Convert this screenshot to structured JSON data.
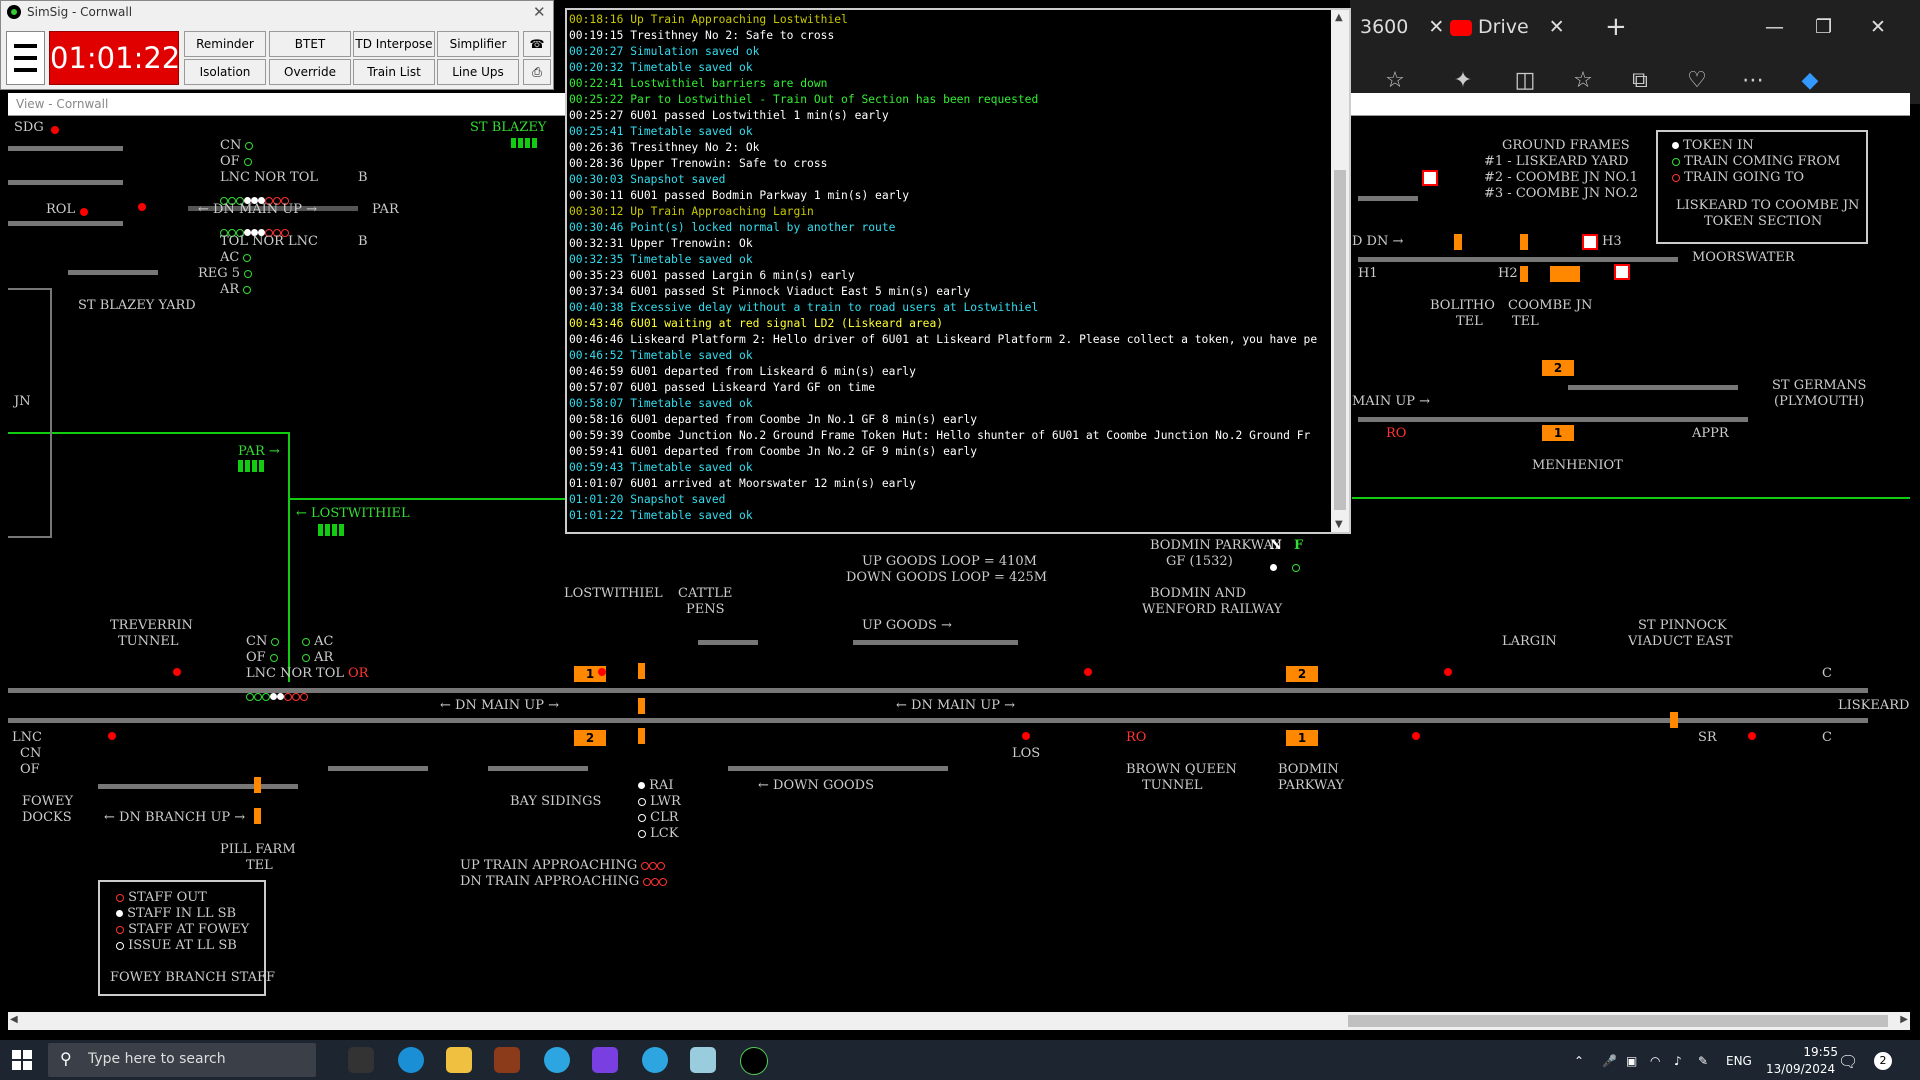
{
  "edge": {
    "tab1_text": "3600",
    "tab2_text": "Drive",
    "close_glyph": "✕",
    "plus_glyph": "+",
    "window_min": "—",
    "window_restore": "❐",
    "window_close": "✕"
  },
  "simsig": {
    "title": "SimSig - Cornwall",
    "clock": "01:01:22",
    "buttons": [
      "Reminder",
      "BTET",
      "TD Interpose",
      "Simplifier",
      "Isolation",
      "Override",
      "Train List",
      "Line Ups"
    ]
  },
  "view": {
    "title": "View - Cornwall"
  },
  "log": [
    {
      "t": "00:18:16 Up Train Approaching Lostwithiel",
      "c": "#c8c800"
    },
    {
      "t": "00:19:15 Tresithney No 2: Safe to cross",
      "c": "#ffffff"
    },
    {
      "t": "00:20:27 Simulation saved ok",
      "c": "#33ddee"
    },
    {
      "t": "00:20:32 Timetable saved ok",
      "c": "#33ddee"
    },
    {
      "t": "00:22:41 Lostwithiel barriers are down",
      "c": "#33ee33"
    },
    {
      "t": "00:25:22 Par to Lostwithiel - Train Out of Section has been requested",
      "c": "#33ee33"
    },
    {
      "t": "00:25:27 6U01 passed Lostwithiel 1 min(s) early",
      "c": "#ffffff"
    },
    {
      "t": "00:25:41 Timetable saved ok",
      "c": "#33ddee"
    },
    {
      "t": "00:26:36 Tresithney No 2: Ok",
      "c": "#ffffff"
    },
    {
      "t": "00:28:36 Upper Trenowin: Safe to cross",
      "c": "#ffffff"
    },
    {
      "t": "00:30:03 Snapshot saved",
      "c": "#33ddee"
    },
    {
      "t": "00:30:11 6U01 passed Bodmin Parkway 1 min(s) early",
      "c": "#ffffff"
    },
    {
      "t": "00:30:12 Up Train Approaching Largin",
      "c": "#c8c800"
    },
    {
      "t": "00:30:46 Point(s) locked normal by another route",
      "c": "#33ddee"
    },
    {
      "t": "00:32:31 Upper Trenowin: Ok",
      "c": "#ffffff"
    },
    {
      "t": "00:32:35 Timetable saved ok",
      "c": "#33ddee"
    },
    {
      "t": "00:35:23 6U01 passed Largin 6 min(s) early",
      "c": "#ffffff"
    },
    {
      "t": "00:37:34 6U01 passed St Pinnock Viaduct East 5 min(s) early",
      "c": "#ffffff"
    },
    {
      "t": "00:40:38 Excessive delay without a train to road users at Lostwithiel",
      "c": "#33ddee"
    },
    {
      "t": "00:43:46 6U01 waiting at red signal LD2 (Liskeard area)",
      "c": "#ffff33"
    },
    {
      "t": "00:46:46 Liskeard Platform 2: Hello driver of 6U01 at Liskeard Platform 2. Please collect a token, you have pe",
      "c": "#ffffff"
    },
    {
      "t": "00:46:52 Timetable saved ok",
      "c": "#33ddee"
    },
    {
      "t": "00:46:59 6U01 departed from Liskeard 6 min(s) early",
      "c": "#ffffff"
    },
    {
      "t": "00:57:07 6U01 passed Liskeard Yard GF on time",
      "c": "#ffffff"
    },
    {
      "t": "00:58:07 Timetable saved ok",
      "c": "#33ddee"
    },
    {
      "t": "00:58:16 6U01 departed from Coombe Jn No.1 GF 8 min(s) early",
      "c": "#ffffff"
    },
    {
      "t": "00:59:39 Coombe Junction No.2 Ground Frame Token Hut: Hello shunter of 6U01 at Coombe Junction No.2 Ground Fr",
      "c": "#ffffff"
    },
    {
      "t": "00:59:41 6U01 departed from Coombe Jn No.2 GF 9 min(s) early",
      "c": "#ffffff"
    },
    {
      "t": "00:59:43 Timetable saved ok",
      "c": "#33ddee"
    },
    {
      "t": "01:01:07 6U01 arrived at Moorswater 12 min(s) early",
      "c": "#ffffff"
    },
    {
      "t": "01:01:20 Snapshot saved",
      "c": "#33ddee"
    },
    {
      "t": "01:01:22 Timetable saved ok",
      "c": "#33ddee"
    }
  ],
  "diagram": {
    "sdg": "SDG",
    "st_blazey": "ST BLAZEY",
    "rol": "ROL",
    "st_blazey_yard": "ST BLAZEY YARD",
    "par_left": "PAR",
    "cn1": "CN",
    "of1": "OF",
    "lnc_nor_tol": "LNC NOR TOL",
    "b1": "B",
    "dn_main_up1": "← DN MAIN UP →",
    "tol_nor_lnc": "TOL NOR LNC",
    "b2": "B",
    "ac1": "AC",
    "reg5": "REG 5",
    "ar1": "AR",
    "jn_left": "JN",
    "par_green": "PAR →",
    "lostwithiel_green": "← LOSTWITHIEL",
    "ground_frames": "GROUND FRAMES",
    "gf1": "#1 - LISKEARD YARD",
    "gf2": "#2 - COOMBE JN NO.1",
    "gf3": "#3 - COOMBE JN NO.2",
    "token_in": "TOKEN IN",
    "train_coming_from": "TRAIN COMING FROM",
    "train_going_to": "TRAIN GOING TO",
    "token_section": "LISKEARD TO COOMBE JN",
    "token_section2": "TOKEN SECTION",
    "dn_right": "D DN →",
    "h1": "H1",
    "h2": "H2",
    "h3": "H3",
    "moorswater": "MOORSWATER",
    "bolitho": "BOLITHO",
    "bolitho_tel": "TEL",
    "coombe_jn": "COOMBE JN",
    "coombe_tel": "TEL",
    "box2_top": "2",
    "box1_top": "1",
    "st_germans": "ST GERMANS",
    "plymouth": "(PLYMOUTH)",
    "main_up_right": "MAIN UP →",
    "ro_right": "RO",
    "appr": "APPR",
    "menheniot": "MENHENIOT",
    "bodmin_pw_gf": "BODMIN PARKWAY",
    "bodmin_gf_num": "GF (1532)",
    "n_lbl": "N",
    "f_lbl": "F",
    "up_goods_loop": "UP GOODS LOOP = 410M",
    "down_goods_loop": "DOWN GOODS LOOP = 425M",
    "lostwithiel": "LOSTWITHIEL",
    "cattle": "CATTLE",
    "pens": "PENS",
    "bodmin_wenford1": "BODMIN AND",
    "bodmin_wenford2": "WENFORD RAILWAY",
    "treverrin1": "TREVERRIN",
    "treverrin2": "TUNNEL",
    "cn2": "CN",
    "of2": "OF",
    "ac2": "AC",
    "ar2": "AR",
    "lnc_nor_tol2": "LNC NOR TOL",
    "or_lbl": "OR",
    "up_goods": "UP GOODS →",
    "largin": "LARGIN",
    "st_pinnock1": "ST PINNOCK",
    "st_pinnock2": "VIADUCT EAST",
    "c_top": "C",
    "liskeard": "LISKEARD",
    "c_bot": "C",
    "dn_main_up2": "← DN MAIN UP →",
    "dn_main_up3": "← DN MAIN UP →",
    "box1_mid": "1",
    "box2_mid": "2",
    "box2_right": "2",
    "box1_right": "1",
    "lnc3": "LNC",
    "cn3": "CN",
    "of3": "OF",
    "los": "LOS",
    "sr": "SR",
    "ro_mid": "RO",
    "fowey1": "FOWEY",
    "fowey2": "DOCKS",
    "dn_branch_up": "← DN BRANCH UP →",
    "bay_sidings": "BAY SIDINGS",
    "rai": "RAI",
    "lwr": "LWR",
    "clr": "CLR",
    "lck": "LCK",
    "down_goods": "← DOWN GOODS",
    "brown_queen1": "BROWN QUEEN",
    "brown_queen2": "TUNNEL",
    "bodmin_parkway1": "BODMIN",
    "bodmin_parkway2": "PARKWAY",
    "pill_farm1": "PILL FARM",
    "pill_farm2": "TEL",
    "up_train_approaching": "UP TRAIN APPROACHING",
    "dn_train_approaching": "DN TRAIN APPROACHING",
    "staff_out": "STAFF OUT",
    "staff_in_ll": "STAFF IN LL SB",
    "staff_at_fowey": "STAFF AT FOWEY",
    "issue_at_ll": "ISSUE AT LL SB",
    "fowey_branch_staff": "FOWEY BRANCH STAFF"
  },
  "taskbar": {
    "search_placeholder": "Type here to search",
    "lang": "ENG",
    "time": "19:55",
    "date": "13/09/2024",
    "notif_count": "2"
  },
  "colors": {
    "clock_bg": "#e00000",
    "diagram_green": "#1c1",
    "platform_orange": "#ff8800"
  }
}
